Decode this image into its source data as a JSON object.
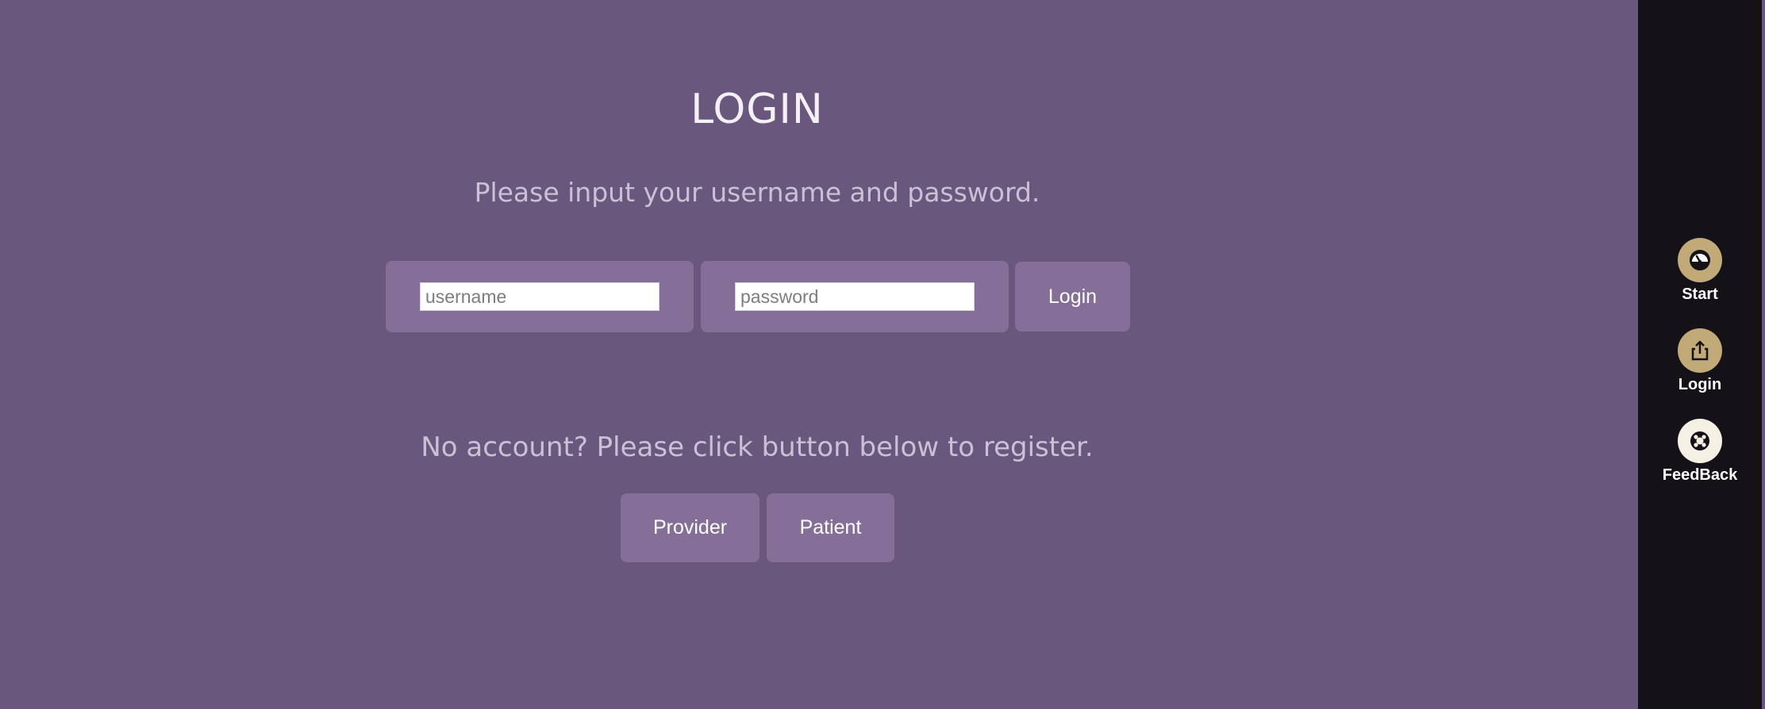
{
  "login": {
    "title": "LOGIN",
    "subtitle": "Please input your username and password.",
    "username_placeholder": "username",
    "username_value": "",
    "password_placeholder": "password",
    "password_value": "",
    "login_button": "Login"
  },
  "register": {
    "prompt": "No account? Please click button below to register.",
    "provider_button": "Provider",
    "patient_button": "Patient"
  },
  "sidebar": {
    "items": [
      {
        "label": "Start",
        "icon": "gauge-icon",
        "circle_color": "#c2aa78"
      },
      {
        "label": "Login",
        "icon": "share-upload-icon",
        "circle_color": "#c2aa78"
      },
      {
        "label": "FeedBack",
        "icon": "lifebuoy-icon",
        "circle_color": "#f5f0e4"
      }
    ]
  },
  "colors": {
    "background": "#6a577d",
    "panel": "#856f99",
    "sidebar": "#141117"
  }
}
